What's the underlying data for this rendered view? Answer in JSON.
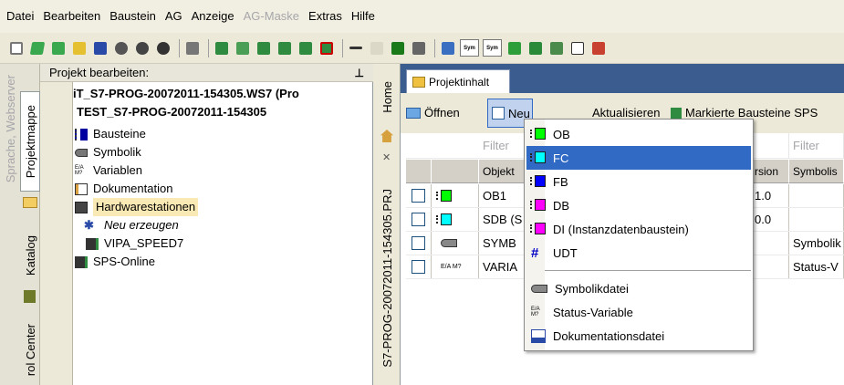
{
  "menubar": {
    "items": [
      "Datei",
      "Bearbeiten",
      "Baustein",
      "AG",
      "Anzeige",
      "AG-Maske",
      "Extras",
      "Hilfe"
    ],
    "disabled": [
      "AG-Maske"
    ]
  },
  "toolbar": {
    "sym1": "Sym",
    "sym2": "Sym"
  },
  "left_strip": {
    "tab_sprache": "Sprache, Webserver",
    "tab_projektmappe": "Projektmappe",
    "tab_katalog": "Katalog",
    "tab_control": "rol Center"
  },
  "project_panel": {
    "header": "Projekt bearbeiten:",
    "pin_icon": "pushpin-icon",
    "tree": [
      {
        "label": "iT_S7-PROG-20072011-154305.WS7 (Pro",
        "bold": true
      },
      {
        "label": "TEST_S7-PROG-20072011-154305",
        "bold": true
      },
      {
        "label": "Bausteine"
      },
      {
        "label": "Symbolik"
      },
      {
        "label": "Variablen",
        "icon_text": "E/A M?"
      },
      {
        "label": "Dokumentation"
      },
      {
        "label": "Hardwarestationen",
        "selected": true
      },
      {
        "label": "Neu erzeugen",
        "italic": true
      },
      {
        "label": "VIPA_SPEED7"
      },
      {
        "label": "SPS-Online"
      }
    ]
  },
  "dock_mid": {
    "home": "Home",
    "project_file": "S7-PROG-20072011-154305.PRJ",
    "close": "✕"
  },
  "right": {
    "tab": "Projektinhalt",
    "open_button": "Öffnen",
    "new_button": "Neu",
    "text_akt": "Aktualisieren",
    "markierte": "Markierte Bausteine SPS",
    "filter_label": "Filter",
    "columns": [
      "",
      "",
      "Objekt",
      "",
      "",
      "",
      "Version",
      "Symbolik"
    ],
    "col_symbolik": "Symbolis",
    "col_version": "rsion",
    "rows": [
      {
        "obj": "OB1",
        "ver": "1.0",
        "sym": ""
      },
      {
        "obj": "SDB (S",
        "ver": "0.0",
        "sym": ""
      },
      {
        "obj": "SYMB",
        "ver": "",
        "sym": "Symbolik"
      },
      {
        "obj": "VARIA",
        "ver": "",
        "sym": "Status-V"
      }
    ],
    "icon_text_var": "E/A M?"
  },
  "popup": {
    "items": [
      {
        "label": "OB",
        "color": "#00ff00"
      },
      {
        "label": "FC",
        "color": "#00ffff",
        "active": true
      },
      {
        "label": "FB",
        "color": "#0000ff"
      },
      {
        "label": "DB",
        "color": "#ff00ff"
      },
      {
        "label": "DI (Instanzdatenbaustein)",
        "color": "#ff00ff"
      },
      {
        "label": "UDT",
        "color": "#0000c8"
      },
      {
        "label": "Symbolikdatei"
      },
      {
        "label": "Status-Variable",
        "icon_text": "E/A M?"
      },
      {
        "label": "Dokumentationsdatei"
      }
    ]
  },
  "colors": {
    "accent": "#316ac5",
    "tabbar": "#3b5c8e",
    "selection": "#f9e9b4"
  }
}
